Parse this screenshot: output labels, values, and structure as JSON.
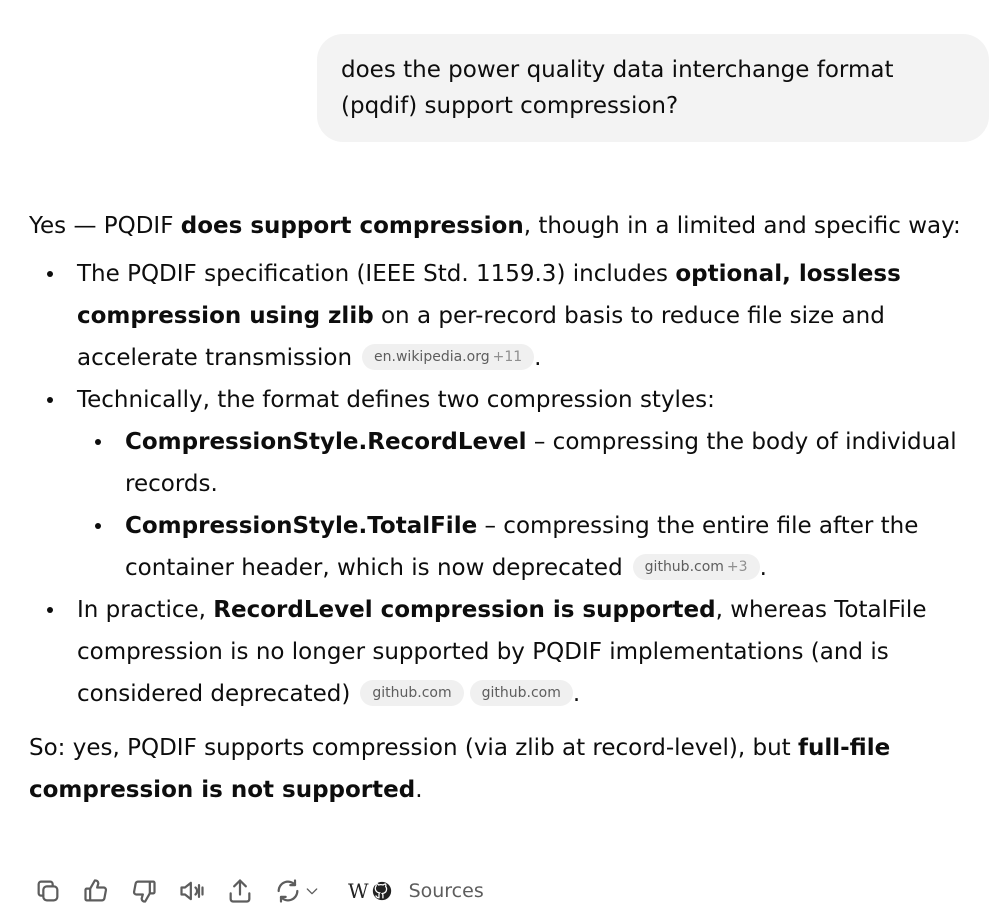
{
  "user_message": "does the power quality data interchange format (pqdif) support compression?",
  "answer": {
    "intro": {
      "t1": "Yes — PQDIF ",
      "b1": "does support compression",
      "t2": ", though in a limited and specific way:"
    },
    "bullet1": {
      "t1": "The PQDIF specification (IEEE Std. 1159.3) includes ",
      "b1": "optional, lossless compression using zlib",
      "t2": " on a per-record basis to reduce file size and accelerate transmission",
      "chip_label": "en.wikipedia.org",
      "chip_more": "+11",
      "t3": "."
    },
    "bullet2": {
      "t1": "Technically, the format defines two compression styles:",
      "sub1": {
        "b1": "CompressionStyle.RecordLevel",
        "t1": " – compressing the body of individual records."
      },
      "sub2": {
        "b1": "CompressionStyle.TotalFile",
        "t1": " – compressing the entire file after the container header, which is now deprecated",
        "chip_label": "github.com",
        "chip_more": "+3",
        "t2": "."
      }
    },
    "bullet3": {
      "t1": "In practice, ",
      "b1": "RecordLevel compression is supported",
      "t2": ", whereas TotalFile compression is no longer supported by PQDIF implementations (and is considered deprecated)",
      "chip1": "github.com",
      "chip2": "github.com",
      "t3": "."
    },
    "conclusion": {
      "t1": "So: yes, PQDIF supports compression (via zlib at record-level), but ",
      "b1": "full-file compression is not supported",
      "t2": "."
    }
  },
  "actions": {
    "sources_label": "Sources",
    "wiki_glyph": "W",
    "icons": [
      "copy-icon",
      "thumbs-up-icon",
      "thumbs-down-icon",
      "read-aloud-icon",
      "share-icon",
      "regenerate-icon",
      "chevron-down-icon",
      "wikipedia-icon",
      "github-icon"
    ]
  }
}
